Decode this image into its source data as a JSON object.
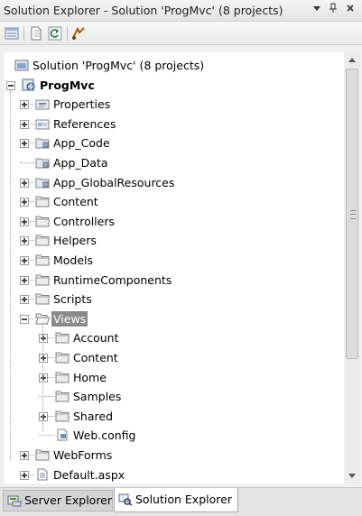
{
  "window": {
    "title": "Solution Explorer - Solution 'ProgMvc' (8 projects)",
    "controls": {
      "dropdown_icon": "dropdown-arrow-icon",
      "pin_icon": "pin-icon",
      "close_icon": "close-icon"
    }
  },
  "toolbar": {
    "buttons": [
      {
        "name": "properties-button",
        "icon": "properties-icon"
      },
      {
        "name": "show-all-files-button",
        "icon": "show-all-files-icon"
      },
      {
        "name": "refresh-button",
        "icon": "refresh-icon"
      },
      {
        "name": "class-diagram-button",
        "icon": "class-diagram-icon"
      }
    ]
  },
  "tree": {
    "solution": {
      "label": "Solution 'ProgMvc' (8 projects)",
      "icon": "solution-icon"
    },
    "project": {
      "label": "ProgMvc",
      "icon": "web-project-icon",
      "expanded": true
    },
    "items": [
      {
        "label": "Properties",
        "icon": "properties-folder-icon",
        "expandable": true
      },
      {
        "label": "References",
        "icon": "references-icon",
        "expandable": true
      },
      {
        "label": "App_Code",
        "icon": "special-folder-icon",
        "expandable": true
      },
      {
        "label": "App_Data",
        "icon": "special-folder-icon",
        "expandable": false
      },
      {
        "label": "App_GlobalResources",
        "icon": "special-folder-icon",
        "expandable": true
      },
      {
        "label": "Content",
        "icon": "folder-icon",
        "expandable": true
      },
      {
        "label": "Controllers",
        "icon": "folder-icon",
        "expandable": true
      },
      {
        "label": "Helpers",
        "icon": "folder-icon",
        "expandable": true
      },
      {
        "label": "Models",
        "icon": "folder-icon",
        "expandable": true
      },
      {
        "label": "RuntimeComponents",
        "icon": "folder-icon",
        "expandable": true
      },
      {
        "label": "Scripts",
        "icon": "folder-icon",
        "expandable": true
      },
      {
        "label": "Views",
        "icon": "open-folder-icon",
        "expandable": true,
        "expanded": true,
        "selected": true
      },
      {
        "label": "Account",
        "icon": "folder-icon",
        "expandable": true,
        "child": true
      },
      {
        "label": "Content",
        "icon": "folder-icon",
        "expandable": true,
        "child": true
      },
      {
        "label": "Home",
        "icon": "folder-icon",
        "expandable": true,
        "child": true
      },
      {
        "label": "Samples",
        "icon": "folder-icon",
        "expandable": false,
        "child": true
      },
      {
        "label": "Shared",
        "icon": "folder-icon",
        "expandable": true,
        "child": true
      },
      {
        "label": "Web.config",
        "icon": "config-file-icon",
        "expandable": false,
        "child": true
      },
      {
        "label": "WebForms",
        "icon": "folder-icon",
        "expandable": true
      },
      {
        "label": "Default.aspx",
        "icon": "aspx-file-icon",
        "expandable": true
      }
    ]
  },
  "tabs": {
    "server_explorer": {
      "label": "Server Explorer",
      "icon": "server-explorer-icon"
    },
    "solution_explorer": {
      "label": "Solution Explorer",
      "icon": "solution-explorer-icon",
      "active": true
    }
  },
  "colors": {
    "selection": "#8b8b8b",
    "folder": "#e9d38a"
  }
}
